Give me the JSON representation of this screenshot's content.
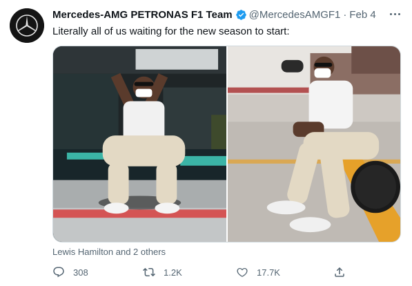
{
  "account": {
    "display_name": "Mercedes-AMG PETRONAS F1 Team",
    "handle": "@MercedesAMGF1",
    "separator": "·",
    "date": "Feb 4",
    "verified": true,
    "verified_color": "#1d9bf0",
    "avatar_icon": "mercedes-star-logo"
  },
  "tweet": {
    "text": "Literally all of us waiting for the new season to start:",
    "tagged": "Lewis Hamilton and 2 others"
  },
  "media": {
    "count": 2
  },
  "actions": {
    "reply_count": "308",
    "retweet_count": "1.2K",
    "like_count": "17.7K",
    "reply_icon": "reply-icon",
    "retweet_icon": "retweet-icon",
    "like_icon": "heart-icon",
    "share_icon": "share-icon"
  },
  "colors": {
    "text_primary": "#0f1419",
    "text_secondary": "#536471",
    "accent": "#1d9bf0"
  }
}
